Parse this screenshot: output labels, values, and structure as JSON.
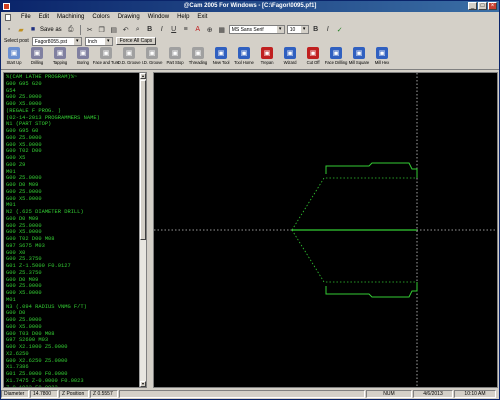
{
  "window": {
    "title": "@Cam 2005 For Windows - [C:\\Fagor\\0095.pf1]",
    "buttons": [
      "_",
      "□",
      "×"
    ]
  },
  "menu": [
    "File",
    "Edit",
    "Machining",
    "Colors",
    "Drawing",
    "Window",
    "Help",
    "Exit"
  ],
  "toolbar1": {
    "save_as_label": "Save as",
    "font_combo": "MS Sans Serif",
    "size_combo": "10"
  },
  "toolbar2": {
    "select_post_label": "Select post",
    "post_value": "Fagor8055.pst",
    "units_value": "Inch",
    "force_caps_label": "Force All Caps"
  },
  "toolbar3": [
    {
      "label": "Start Up",
      "color": "#6a8fd0",
      "icon": "start-up-icon"
    },
    {
      "label": "Drilling",
      "color": "#8080a0",
      "icon": "drill-icon"
    },
    {
      "label": "Tapping",
      "color": "#8080a0",
      "icon": "tap-icon"
    },
    {
      "label": "Boring",
      "color": "#8080a0",
      "icon": "boring-icon"
    },
    {
      "label": "Face and Turn",
      "color": "#a0a0a0",
      "icon": "face-turn-icon"
    },
    {
      "label": "O.D. Groove",
      "color": "#a0a0a0",
      "icon": "od-groove-icon"
    },
    {
      "label": "I.D. Groove",
      "color": "#a0a0a0",
      "icon": "id-groove-icon"
    },
    {
      "label": "Part Stop",
      "color": "#a0a0a0",
      "icon": "part-stop-icon"
    },
    {
      "label": "Threading",
      "color": "#a0a0a0",
      "icon": "threading-icon"
    },
    {
      "label": "New Tool",
      "color": "#3060c0",
      "icon": "new-tool-icon"
    },
    {
      "label": "Tool Home",
      "color": "#3060c0",
      "icon": "tool-home-icon"
    },
    {
      "label": "Trepan",
      "color": "#c02020",
      "icon": "trepan-icon"
    },
    {
      "label": "Wizard",
      "color": "#3060c0",
      "icon": "wizard-icon"
    },
    {
      "label": "Cut Off",
      "color": "#c02020",
      "icon": "cut-off-icon"
    },
    {
      "label": "Face Drilling",
      "color": "#3060c0",
      "icon": "face-drilling-icon"
    },
    {
      "label": "Mill Square",
      "color": "#3060c0",
      "icon": "mill-square-icon"
    },
    {
      "label": "Mill Hex",
      "color": "#3060c0",
      "icon": "mill-hex-icon"
    }
  ],
  "code_lines": [
    "%(CAM LATHE PROGRAM)%~",
    "G00 G95 G20",
    "G54",
    "G00 Z5.0000",
    "G00 X5.0000",
    "(REGALE F PROG. )",
    "(02-14-2013 PROGRAMMERS NAME)",
    "N1 (PART STOP)",
    "G00 G95 G0",
    "G00 Z5.0000",
    "G00 X5.0000",
    "G00 T02 D00",
    "G00 X5",
    "G00 Z9",
    "M01",
    "G00 Z5.0000",
    "G00 D0 M09",
    "G00 Z5.0000",
    "G00 X5.0000",
    "M01",
    "N2 (.625 DIAMETER DRILL)",
    "G00 D0 M09",
    "G00 Z5.0000",
    "G00 X5.0000",
    "G00 T02 D00 M08",
    "G97 S675 M03",
    "G00 X0",
    "G00 Z5.3750",
    "G01 Z-1.5000 F0.0127",
    "G00 Z5.3750",
    "G00 D0 M09",
    "G00 Z5.0000",
    "G00 X5.0000",
    "M01",
    "N3 (.094 RADIUS VNMG F/T)",
    "G00 D0",
    "G00 Z5.0000",
    "G00 X5.0000",
    "G00 T03 D00 M08",
    "G97 S2600 M03",
    "G00 X2.1000 Z5.0000",
    "X2.6250",
    "G00 X2.6250 Z5.0000",
    "X1.7386",
    "G01 Z5.0000 F0.0000",
    "X1.7475 Z-0.0000 F0.0023",
    "Z-0.1023 F0.0023",
    "X1.0774 Z-0.1638 F0.0023",
    "Z-1.4000 F0.0023",
    "X1.0980 F0.0023"
  ],
  "status": {
    "diameter_label": "Diameter",
    "diameter_value": "14.7800",
    "z_label": "Z Position",
    "z_value": "Z 0.5557",
    "num_lock": "NUM",
    "date": "4/6/2013",
    "time": "10:10 AM"
  },
  "colors": {
    "code_text": "#33cc33",
    "toolpath": "#33cc33",
    "centerline": "#cccccc",
    "background": "#000000"
  }
}
